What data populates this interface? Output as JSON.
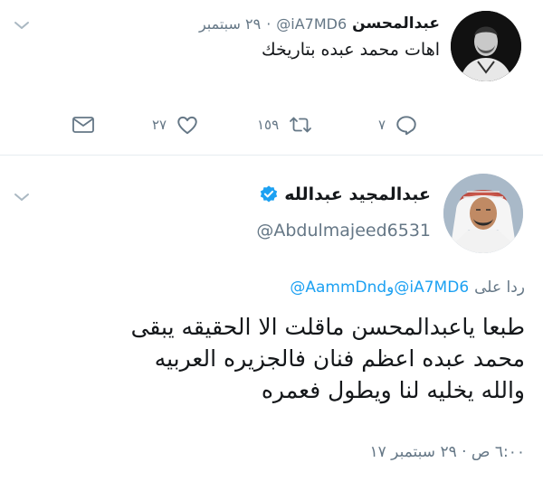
{
  "colors": {
    "text": "#14171a",
    "muted": "#657786",
    "link": "#1da1f2",
    "divider": "#e6ecf0",
    "like": "#e0245e"
  },
  "reply_tweet": {
    "author_name": "عبدالمحسن",
    "handle": "@iA7MD6",
    "separator": "·",
    "date": "٢٩ سبتمبر",
    "text": "اهات محمد عبده بتاريخك",
    "counts": {
      "reply": "٧",
      "retweet": "١٥٩",
      "like": "٢٧"
    }
  },
  "main_tweet": {
    "author_name": "عبدالمجيد عبدالله",
    "verified": true,
    "handle": "@Abdulmajeed6531",
    "replying_to": {
      "label": "ردا على",
      "mention_1": "@iA7MD6",
      "conjunction": "و",
      "mention_2": "@AammDnd"
    },
    "text_lines": [
      "طبعا ياعبدالمحسن ماقلت الا الحقيقه يبقى",
      "محمد عبده اعظم فنان فالجزيره العربيه",
      "والله يخليه لنا ويطول فعمره"
    ],
    "timestamp": "٦:٠٠ ص · ٢٩ سبتمبر ١٧"
  },
  "icons": {
    "reply": "reply-icon",
    "retweet": "retweet-icon",
    "like": "heart-icon",
    "dm": "mail-icon",
    "menu": "chevron-down-icon",
    "verified": "verified-badge-icon"
  }
}
